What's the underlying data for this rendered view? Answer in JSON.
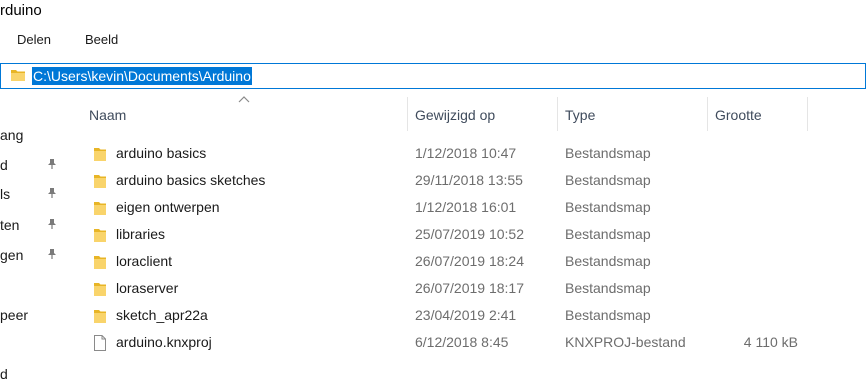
{
  "window": {
    "title": "rduino"
  },
  "ribbon": {
    "tabs": [
      "Delen",
      "Beeld"
    ]
  },
  "address_bar": {
    "path": "C:\\Users\\kevin\\Documents\\Arduino",
    "icon": "folder-icon"
  },
  "nav_pane": {
    "items": [
      {
        "label": "ang",
        "pinned": false
      },
      {
        "label": "d",
        "pinned": true
      },
      {
        "label": "ls",
        "pinned": true
      },
      {
        "label": "ten",
        "pinned": true
      },
      {
        "label": "gen",
        "pinned": true
      },
      {
        "label": "peer",
        "pinned": false
      },
      {
        "label": "d",
        "pinned": false
      }
    ]
  },
  "columns": {
    "name": "Naam",
    "modified": "Gewijzigd op",
    "type": "Type",
    "size": "Grootte"
  },
  "files": [
    {
      "name": "arduino basics",
      "modified": "1/12/2018 10:47",
      "type": "Bestandsmap",
      "size": "",
      "icon": "folder-icon"
    },
    {
      "name": "arduino basics sketches",
      "modified": "29/11/2018 13:55",
      "type": "Bestandsmap",
      "size": "",
      "icon": "folder-icon"
    },
    {
      "name": "eigen ontwerpen",
      "modified": "1/12/2018 16:01",
      "type": "Bestandsmap",
      "size": "",
      "icon": "folder-icon"
    },
    {
      "name": "libraries",
      "modified": "25/07/2019 10:52",
      "type": "Bestandsmap",
      "size": "",
      "icon": "folder-icon"
    },
    {
      "name": "loraclient",
      "modified": "26/07/2019 18:24",
      "type": "Bestandsmap",
      "size": "",
      "icon": "folder-icon"
    },
    {
      "name": "loraserver",
      "modified": "26/07/2019 18:17",
      "type": "Bestandsmap",
      "size": "",
      "icon": "folder-icon"
    },
    {
      "name": "sketch_apr22a",
      "modified": "23/04/2019 2:41",
      "type": "Bestandsmap",
      "size": "",
      "icon": "folder-icon"
    },
    {
      "name": "arduino.knxproj",
      "modified": "6/12/2018 8:45",
      "type": "KNXPROJ-bestand",
      "size": "4 110 kB",
      "icon": "file-icon"
    }
  ],
  "colors": {
    "accent": "#0078d7",
    "folder": "#f5c518",
    "header_text": "#3f4b5c",
    "secondary_text": "#6d6d6d"
  }
}
